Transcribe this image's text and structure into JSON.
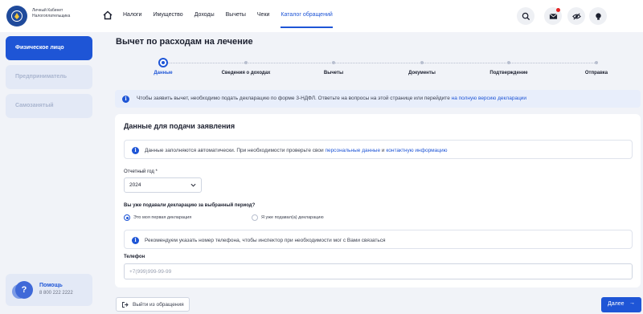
{
  "header": {
    "logo_text": "Личный Кабинет Налогоплательщика",
    "nav": [
      "Налоги",
      "Имущество",
      "Доходы",
      "Вычеты",
      "Чеки",
      "Каталог обращений"
    ],
    "active_nav": "Каталог обращений"
  },
  "sidebar": {
    "items": [
      {
        "label": "Физическое лицо",
        "state": "active"
      },
      {
        "label": "Предприниматель",
        "state": "inactive"
      },
      {
        "label": "Самозанятый",
        "state": "inactive"
      }
    ],
    "help": {
      "icon_text": "?",
      "title": "Помощь",
      "phone": "8 800 222 2222"
    }
  },
  "main": {
    "title": "Вычет по расходам на лечение",
    "steps": [
      {
        "label": "Данные",
        "active": true
      },
      {
        "label": "Сведения о доходах",
        "active": false
      },
      {
        "label": "Вычеты",
        "active": false
      },
      {
        "label": "Документы",
        "active": false
      },
      {
        "label": "Подтверждение",
        "active": false
      },
      {
        "label": "Отправка",
        "active": false
      }
    ],
    "banner": {
      "text": "Чтобы заявить вычет, необходимо подать декларацию по форме 3-НДФЛ. Ответьте на вопросы на этой странице или перейдите ",
      "link": "на полную версию декларации"
    },
    "card": {
      "title": "Данные для подачи заявления",
      "note": {
        "text1": "Данные заполняются автоматически. При необходимости проверьте свои ",
        "link1": "персональные данные",
        "text2": " и ",
        "link2": "контактную информацию"
      },
      "year_label": "Отчетный год *",
      "year_value": "2024",
      "question": "Вы уже подавали декларацию за выбранный период?",
      "options": [
        {
          "label": "Это моя первая декларация",
          "selected": true
        },
        {
          "label": "Я уже подавал(а) декларацию",
          "selected": false
        }
      ],
      "phone_note": "Рекомендуем указать номер телефона, чтобы инспектор при необходимости мог с Вами связаться",
      "phone_label": "Телефон",
      "phone_placeholder": "+7(999)999-99-99"
    },
    "back_button": "Выйти из обращения",
    "next_button": "Далее",
    "info_glyph": "i"
  },
  "colors": {
    "accent": "#1e55d6",
    "background": "#f1f3f8",
    "notification": "#e32525"
  },
  "icons": [
    "home-icon",
    "search-icon",
    "mail-icon",
    "eye-off-icon",
    "lightbulb-icon",
    "info-icon",
    "chevron-down-icon",
    "exit-icon",
    "arrow-right-icon"
  ]
}
